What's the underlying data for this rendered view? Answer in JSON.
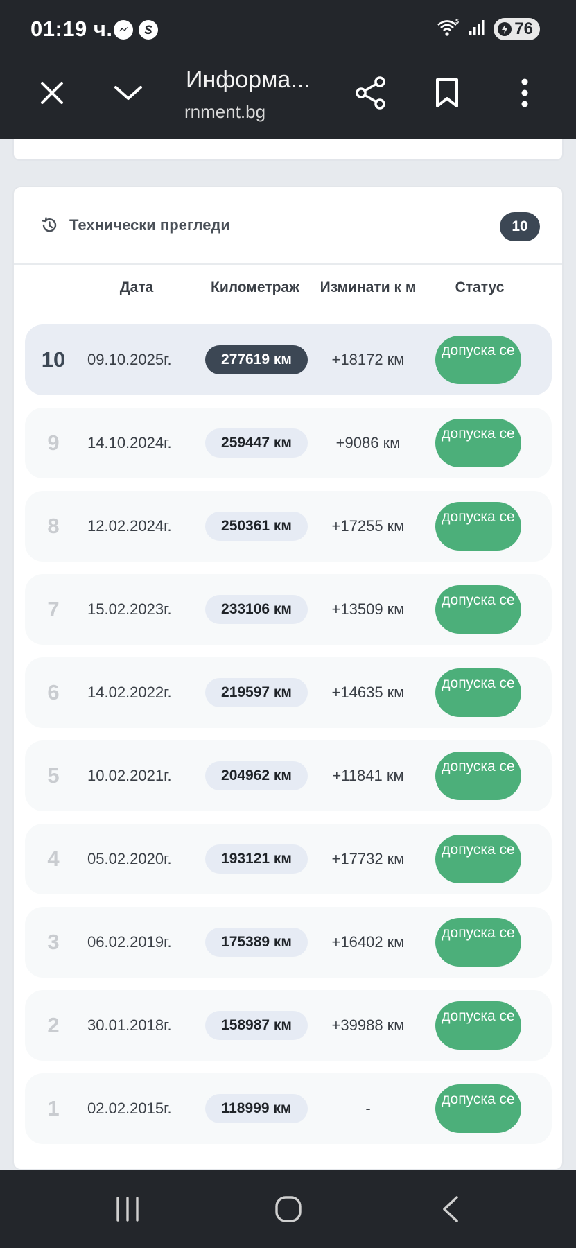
{
  "status_bar": {
    "time": "01:19 ч.",
    "battery": "76",
    "icons": [
      "messenger-icon",
      "skype-icon",
      "wifi-icon",
      "signal-icon",
      "battery-icon"
    ]
  },
  "toolbar": {
    "title": "Информа...",
    "url": "rnment.bg",
    "icons": [
      "close-icon",
      "chevron-down-icon",
      "share-icon",
      "bookmark-icon",
      "more-vert-icon"
    ]
  },
  "card": {
    "title": "Технически прегледи",
    "count": "10",
    "icon": "history-icon"
  },
  "table": {
    "headers": {
      "date": "Дата",
      "mileage": "Километраж",
      "traveled": "Изминати к м",
      "status": "Статус"
    },
    "rows": [
      {
        "num": "10",
        "date": "09.10.2025г.",
        "km": "277619 км",
        "delta": "+18172 км",
        "status": "допуска се",
        "current": true
      },
      {
        "num": "9",
        "date": "14.10.2024г.",
        "km": "259447 км",
        "delta": "+9086 км",
        "status": "допуска се"
      },
      {
        "num": "8",
        "date": "12.02.2024г.",
        "km": "250361 км",
        "delta": "+17255 км",
        "status": "допуска се"
      },
      {
        "num": "7",
        "date": "15.02.2023г.",
        "km": "233106 км",
        "delta": "+13509 км",
        "status": "допуска се"
      },
      {
        "num": "6",
        "date": "14.02.2022г.",
        "km": "219597 км",
        "delta": "+14635 км",
        "status": "допуска се"
      },
      {
        "num": "5",
        "date": "10.02.2021г.",
        "km": "204962 км",
        "delta": "+11841 км",
        "status": "допуска се"
      },
      {
        "num": "4",
        "date": "05.02.2020г.",
        "km": "193121 км",
        "delta": "+17732 км",
        "status": "допуска се"
      },
      {
        "num": "3",
        "date": "06.02.2019г.",
        "km": "175389 км",
        "delta": "+16402 км",
        "status": "допуска се"
      },
      {
        "num": "2",
        "date": "30.01.2018г.",
        "km": "158987 км",
        "delta": "+39988 км",
        "status": "допуска се"
      },
      {
        "num": "1",
        "date": "02.02.2015г.",
        "km": "118999 км",
        "delta": "-",
        "status": "допуска се"
      }
    ]
  },
  "colors": {
    "dark_bar": "#23262b",
    "badge_dark": "#3c4754",
    "status_green": "#4caf7a",
    "km_pill": "#e6ebf4"
  },
  "nav": {
    "icons": [
      "recent-apps-icon",
      "home-icon",
      "back-icon"
    ]
  }
}
